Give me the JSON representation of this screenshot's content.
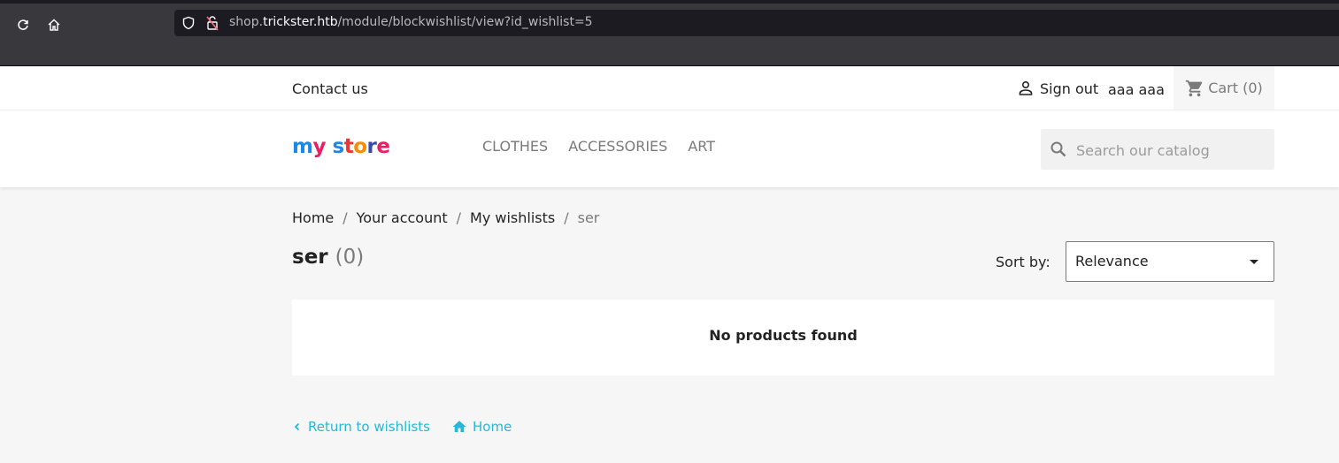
{
  "browser": {
    "url_prefix": "shop.",
    "url_host": "trickster.htb",
    "url_path": "/module/blockwishlist/view?id_wishlist=5"
  },
  "topnav": {
    "contact": "Contact us",
    "signout": "Sign out",
    "username": "aaa aaa",
    "cart": "Cart (0)"
  },
  "header": {
    "logo_text": "my store",
    "menu": [
      "CLOTHES",
      "ACCESSORIES",
      "ART"
    ],
    "search_placeholder": "Search our catalog"
  },
  "breadcrumb": [
    "Home",
    "Your account",
    "My wishlists",
    "ser"
  ],
  "wishlist": {
    "name": "ser",
    "count": "(0)"
  },
  "sort": {
    "label": "Sort by:",
    "selected": "Relevance"
  },
  "results": {
    "empty_message": "No products found"
  },
  "footer_links": {
    "return": "Return to wishlists",
    "home": "Home"
  },
  "colors": {
    "link": "#24b9d7",
    "chrome": "#38383d"
  }
}
